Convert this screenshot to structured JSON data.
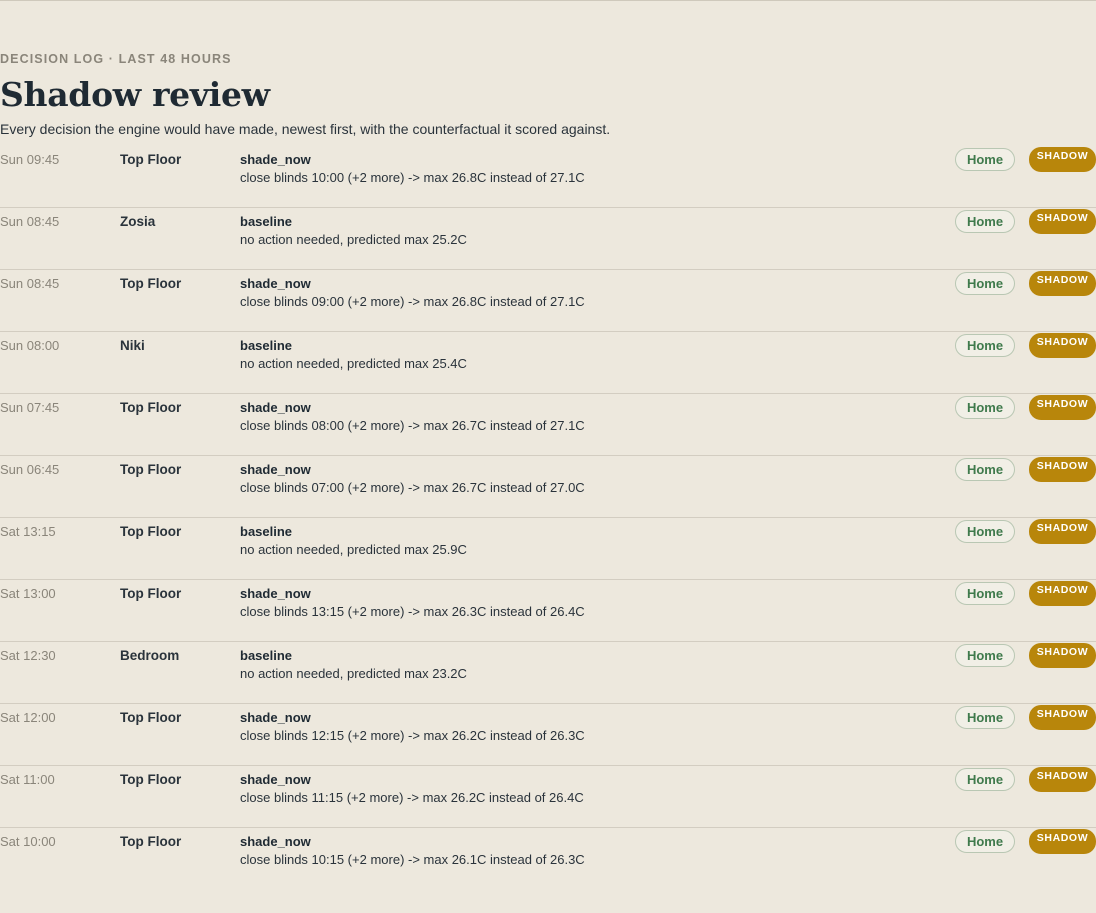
{
  "header": {
    "eyebrow": "DECISION LOG · LAST 48 HOURS",
    "title": "Shadow review",
    "subtitle": "Every decision the engine would have made, newest first, with the counterfactual it scored against."
  },
  "colors": {
    "background": "#ede8dd",
    "shadow_badge": "#b8860b",
    "home_badge_text": "#3f7a4c"
  },
  "entries": [
    {
      "time": "Sun 09:45",
      "room": "Top Floor",
      "action": "shade_now",
      "detail": "close blinds 10:00 (+2 more) -> max 26.8C instead of 27.1C",
      "scope": "Home",
      "mode": "SHADOW"
    },
    {
      "time": "Sun 08:45",
      "room": "Zosia",
      "action": "baseline",
      "detail": "no action needed, predicted max 25.2C",
      "scope": "Home",
      "mode": "SHADOW"
    },
    {
      "time": "Sun 08:45",
      "room": "Top Floor",
      "action": "shade_now",
      "detail": "close blinds 09:00 (+2 more) -> max 26.8C instead of 27.1C",
      "scope": "Home",
      "mode": "SHADOW"
    },
    {
      "time": "Sun 08:00",
      "room": "Niki",
      "action": "baseline",
      "detail": "no action needed, predicted max 25.4C",
      "scope": "Home",
      "mode": "SHADOW"
    },
    {
      "time": "Sun 07:45",
      "room": "Top Floor",
      "action": "shade_now",
      "detail": "close blinds 08:00 (+2 more) -> max 26.7C instead of 27.1C",
      "scope": "Home",
      "mode": "SHADOW"
    },
    {
      "time": "Sun 06:45",
      "room": "Top Floor",
      "action": "shade_now",
      "detail": "close blinds 07:00 (+2 more) -> max 26.7C instead of 27.0C",
      "scope": "Home",
      "mode": "SHADOW"
    },
    {
      "time": "Sat 13:15",
      "room": "Top Floor",
      "action": "baseline",
      "detail": "no action needed, predicted max 25.9C",
      "scope": "Home",
      "mode": "SHADOW"
    },
    {
      "time": "Sat 13:00",
      "room": "Top Floor",
      "action": "shade_now",
      "detail": "close blinds 13:15 (+2 more) -> max 26.3C instead of 26.4C",
      "scope": "Home",
      "mode": "SHADOW"
    },
    {
      "time": "Sat 12:30",
      "room": "Bedroom",
      "action": "baseline",
      "detail": "no action needed, predicted max 23.2C",
      "scope": "Home",
      "mode": "SHADOW"
    },
    {
      "time": "Sat 12:00",
      "room": "Top Floor",
      "action": "shade_now",
      "detail": "close blinds 12:15 (+2 more) -> max 26.2C instead of 26.3C",
      "scope": "Home",
      "mode": "SHADOW"
    },
    {
      "time": "Sat 11:00",
      "room": "Top Floor",
      "action": "shade_now",
      "detail": "close blinds 11:15 (+2 more) -> max 26.2C instead of 26.4C",
      "scope": "Home",
      "mode": "SHADOW"
    },
    {
      "time": "Sat 10:00",
      "room": "Top Floor",
      "action": "shade_now",
      "detail": "close blinds 10:15 (+2 more) -> max 26.1C instead of 26.3C",
      "scope": "Home",
      "mode": "SHADOW"
    }
  ]
}
